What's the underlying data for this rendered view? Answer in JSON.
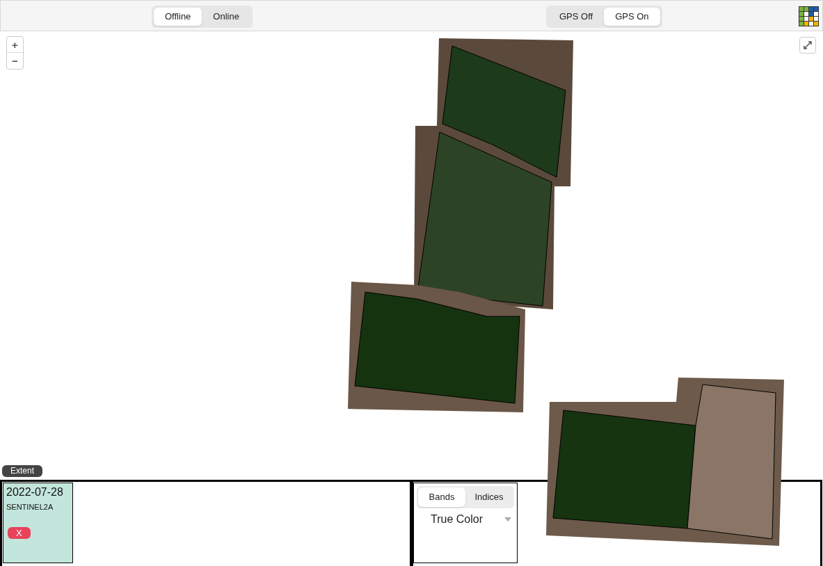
{
  "top_bar": {
    "mode_toggle": [
      {
        "label": "Offline",
        "selected": true
      },
      {
        "label": "Online",
        "selected": false
      }
    ],
    "gps_toggle": [
      {
        "label": "GPS Off",
        "selected": false
      },
      {
        "label": "GPS On",
        "selected": true
      }
    ]
  },
  "map": {
    "zoom_in": "+",
    "zoom_out": "−",
    "extent_button": "Extent"
  },
  "scenes": [
    {
      "date": "2022-07-28",
      "satellite": "SENTINEL2A",
      "remove_label": "X"
    }
  ],
  "layer_panel": {
    "tabs": [
      {
        "label": "Bands",
        "selected": true
      },
      {
        "label": "Indices",
        "selected": false
      }
    ],
    "layer_select": "True Color"
  }
}
